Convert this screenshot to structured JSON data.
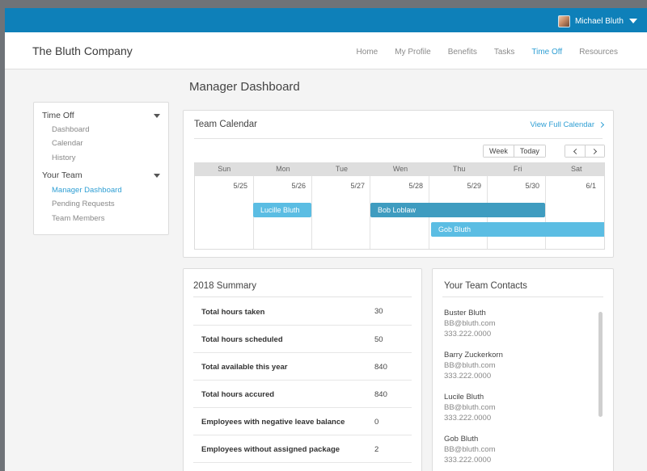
{
  "user": {
    "name": "Michael Bluth"
  },
  "header": {
    "brand": "The Bluth Company",
    "nav": [
      {
        "label": "Home"
      },
      {
        "label": "My Profile"
      },
      {
        "label": "Benefits"
      },
      {
        "label": "Tasks"
      },
      {
        "label": "Time Off",
        "active": true
      },
      {
        "label": "Resources"
      }
    ]
  },
  "page": {
    "title": "Manager Dashboard"
  },
  "sidebar": {
    "sections": [
      {
        "title": "Time Off",
        "items": [
          "Dashboard",
          "Calendar",
          "History"
        ]
      },
      {
        "title": "Your Team",
        "items": [
          "Manager Dashboard",
          "Pending Requests",
          "Team Members"
        ],
        "active_item": "Manager Dashboard"
      }
    ]
  },
  "calendar": {
    "title": "Team Calendar",
    "view_full": "View Full Calendar",
    "buttons": {
      "week": "Week",
      "today": "Today"
    },
    "days": [
      "Sun",
      "Mon",
      "Tue",
      "Wen",
      "Thu",
      "Fri",
      "Sat"
    ],
    "dates": [
      "5/25",
      "5/26",
      "5/27",
      "5/28",
      "5/29",
      "5/30",
      "6/1"
    ],
    "events": [
      {
        "name": "Lucille Bluth",
        "color": "#5bbde3"
      },
      {
        "name": "Bob Loblaw",
        "color": "#3f9cc0"
      },
      {
        "name": "Gob Bluth",
        "color": "#5bbde3"
      }
    ]
  },
  "summary": {
    "title": "2018 Summary",
    "rows": [
      {
        "label": "Total hours taken",
        "value": "30"
      },
      {
        "label": "Total hours scheduled",
        "value": "50"
      },
      {
        "label": "Total available this year",
        "value": "840"
      },
      {
        "label": "Total hours accured",
        "value": "840"
      },
      {
        "label": "Employees with negative leave balance",
        "value": "0"
      },
      {
        "label": "Employees without assigned package",
        "value": "2"
      }
    ]
  },
  "contacts": {
    "title": "Your Team Contacts",
    "list": [
      {
        "name": "Buster Bluth",
        "email": "BB@bluth.com",
        "phone": "333.222.0000"
      },
      {
        "name": "Barry Zuckerkorn",
        "email": "BB@bluth.com",
        "phone": "333.222.0000"
      },
      {
        "name": "Lucile Bluth",
        "email": "BB@bluth.com",
        "phone": "333.222.0000"
      },
      {
        "name": "Gob Bluth",
        "email": "BB@bluth.com",
        "phone": "333.222.0000"
      }
    ]
  },
  "colors": {
    "brand_blue": "#0e80b9",
    "accent": "#2f9fd4",
    "event_light": "#5bbde3",
    "event_dark": "#3f9cc0"
  }
}
